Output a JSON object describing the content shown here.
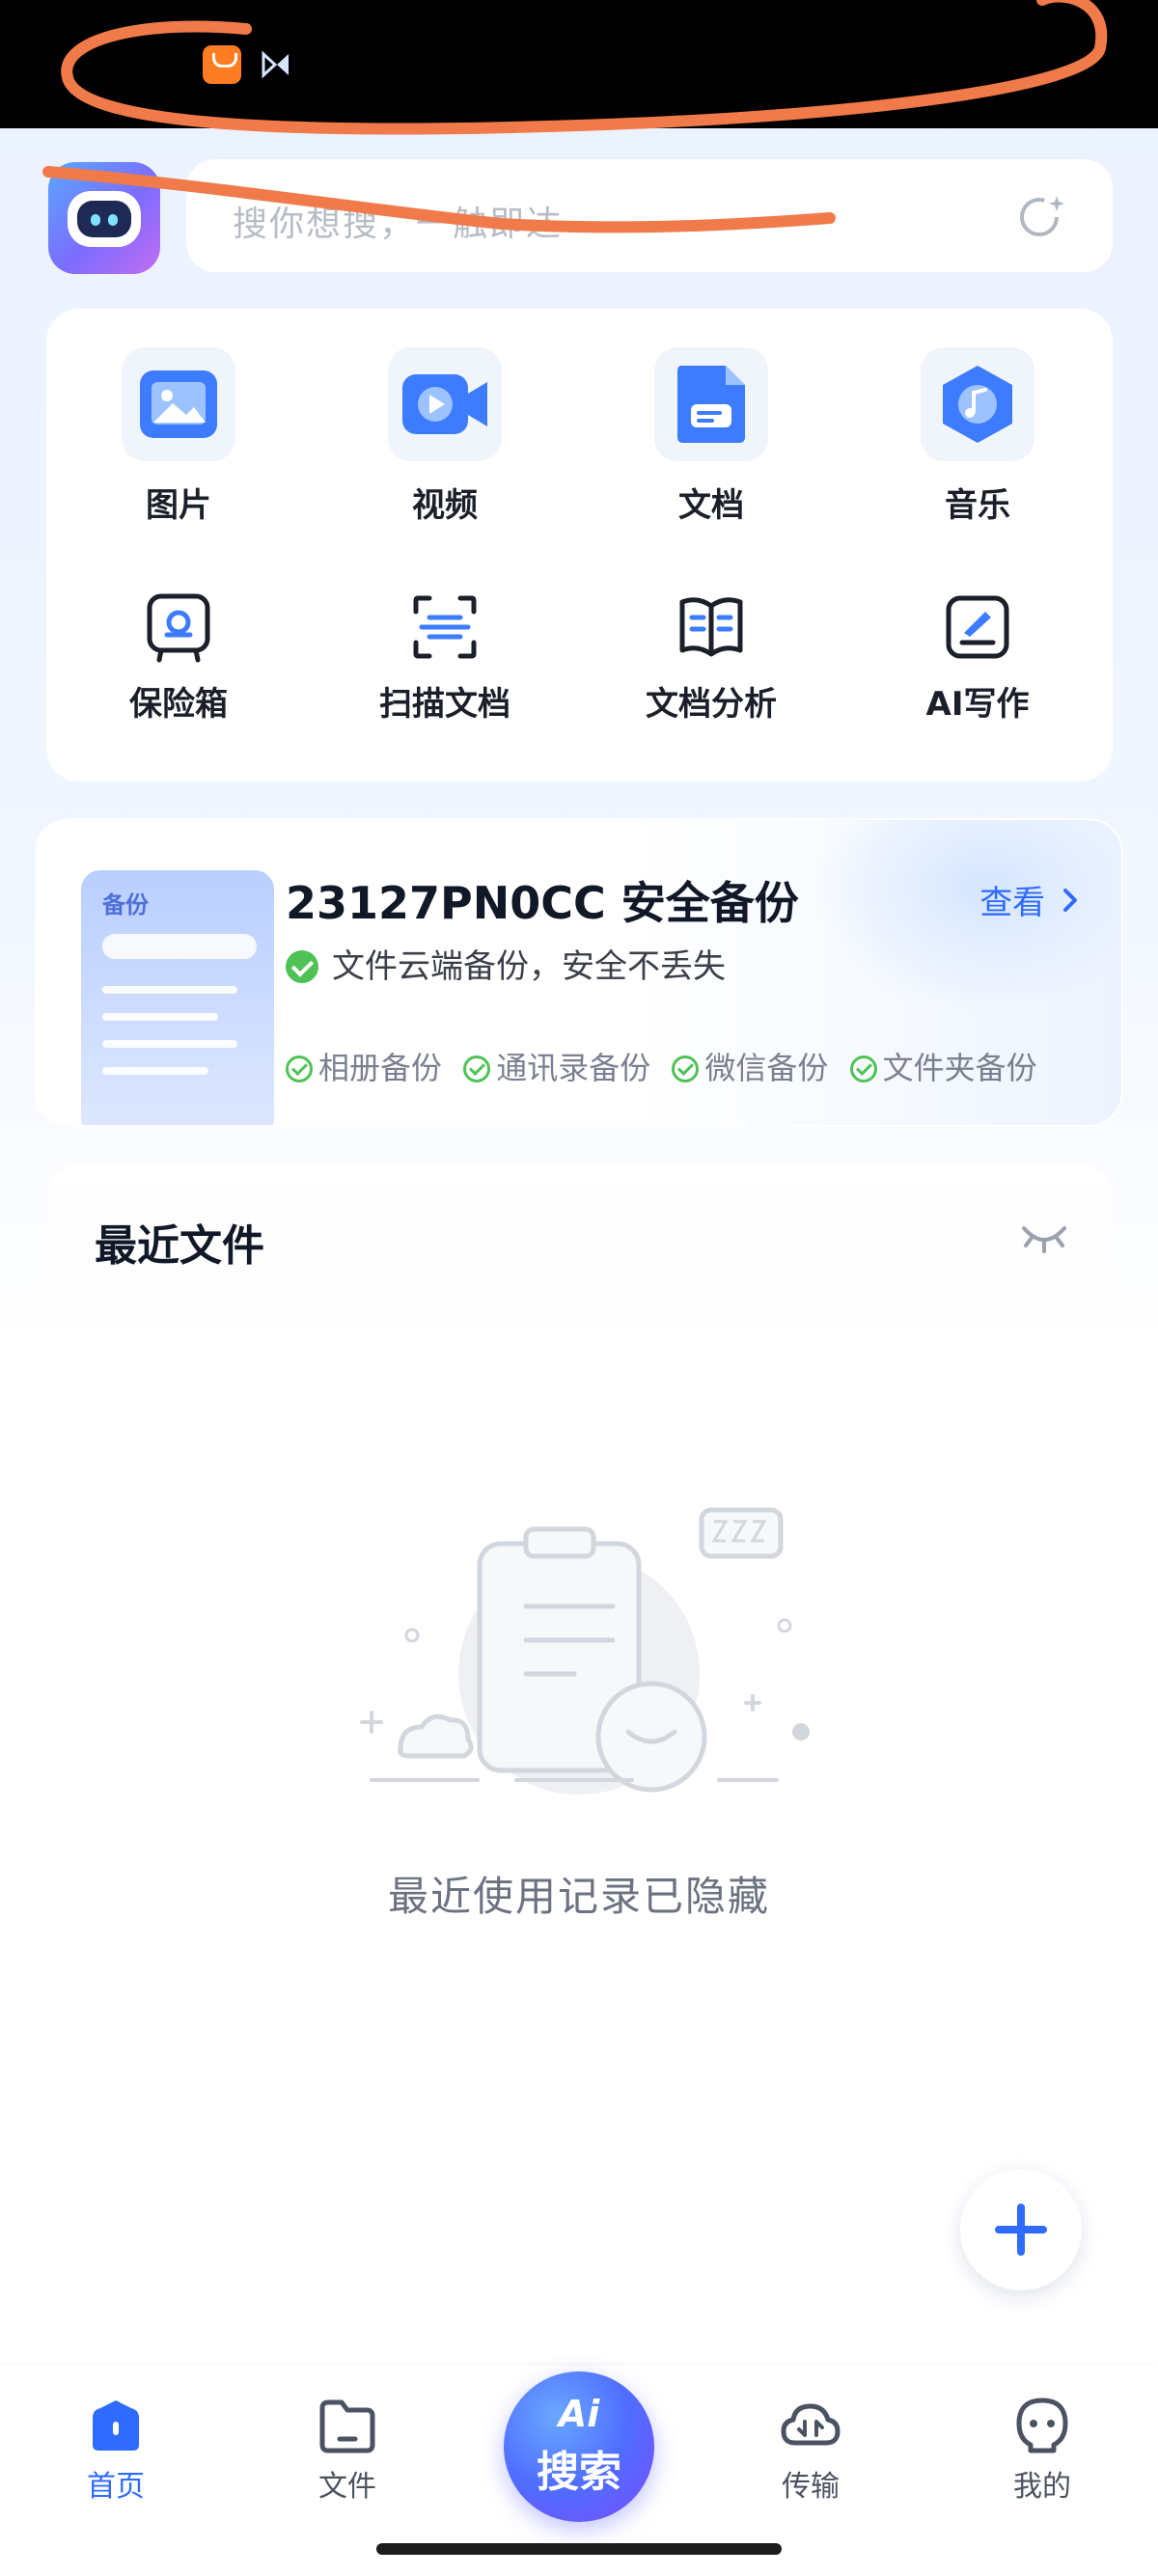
{
  "search": {
    "placeholder": "搜你想搜，一触即达"
  },
  "quick_access": {
    "media": [
      {
        "label": "图片",
        "icon": "image-icon"
      },
      {
        "label": "视频",
        "icon": "video-icon"
      },
      {
        "label": "文档",
        "icon": "document-icon"
      },
      {
        "label": "音乐",
        "icon": "music-icon"
      }
    ],
    "tools": [
      {
        "label": "保险箱",
        "icon": "safe-icon"
      },
      {
        "label": "扫描文档",
        "icon": "scan-icon"
      },
      {
        "label": "文档分析",
        "icon": "book-icon"
      },
      {
        "label": "AI写作",
        "icon": "ai-write-icon"
      }
    ]
  },
  "backup": {
    "illustration_label": "备份",
    "title": "23127PN0CC 安全备份",
    "view_label": "查看",
    "subtitle": "文件云端备份，安全不丢失",
    "tags": [
      "相册备份",
      "通讯录备份",
      "微信备份",
      "文件夹备份"
    ]
  },
  "recent": {
    "title": "最近文件",
    "empty_text": "最近使用记录已隐藏"
  },
  "bottom_nav": {
    "home": "首页",
    "files": "文件",
    "ai_top": "Ai",
    "ai_label": "搜索",
    "transfer": "传输",
    "mine": "我的"
  },
  "colors": {
    "accent": "#2f6bff",
    "check_green": "#4fc256",
    "status_bar": "#000000",
    "scribble": "#f07a4a"
  }
}
